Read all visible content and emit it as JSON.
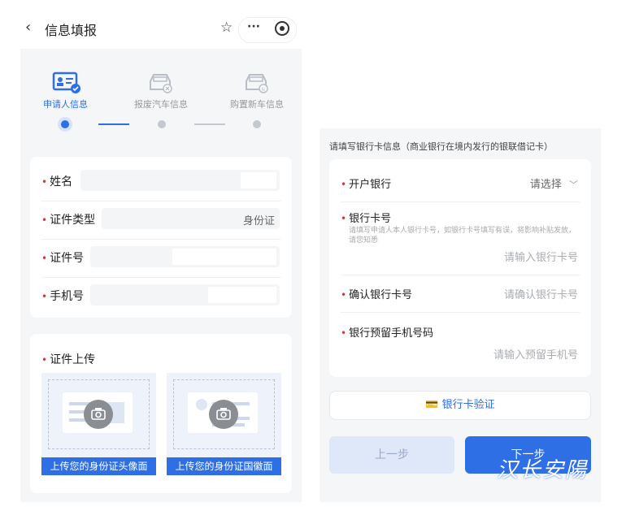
{
  "left": {
    "header": {
      "title": "信息填报"
    },
    "steps": [
      {
        "label": "申请人信息"
      },
      {
        "label": "报废汽车信息"
      },
      {
        "label": "购置新车信息"
      }
    ],
    "form": {
      "name_label": "姓名",
      "id_type_label": "证件类型",
      "id_type_value": "身份证",
      "id_number_label": "证件号",
      "phone_label": "手机号"
    },
    "upload": {
      "title": "证件上传",
      "front_caption": "上传您的身份证头像面",
      "back_caption": "上传您的身份证国徽面"
    }
  },
  "right": {
    "notice": "请填写银行卡信息（商业银行在境内发行的银联借记卡）",
    "bank_label": "开户银行",
    "bank_value": "请选择",
    "card_label": "银行卡号",
    "card_hint": "请填写申请人本人银行卡号，如银行卡号填写有误，将影响补贴发放，请您知悉",
    "card_placeholder": "请输入银行卡号",
    "confirm_label": "确认银行卡号",
    "confirm_placeholder": "请确认银行卡号",
    "phone_label": "银行预留手机号码",
    "phone_placeholder": "请输入预留手机号",
    "verify_button": "银行卡验证",
    "prev_button": "上一步",
    "next_button": "下一步",
    "watermark": "汉长安陽"
  },
  "colors": {
    "primary": "#2f6fe6",
    "required": "#e0342e",
    "disabled": "#dfe8f8"
  }
}
